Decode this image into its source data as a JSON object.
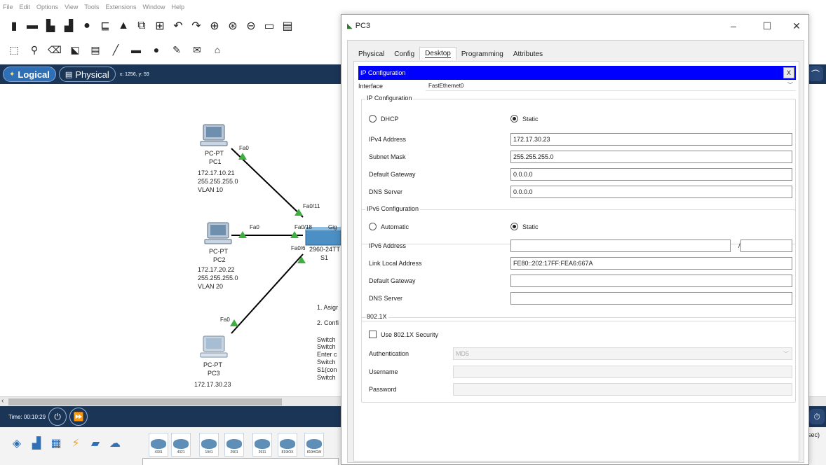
{
  "menu": [
    "File",
    "Edit",
    "Options",
    "View",
    "Tools",
    "Extensions",
    "Window",
    "Help"
  ],
  "toolbar1_icons": [
    "new-file-icon",
    "open-folder-icon",
    "save-icon",
    "print-icon",
    "activity-wizard-icon",
    "network-info-icon",
    "custom-device-icon",
    "copy-icon",
    "paste-icon",
    "undo-icon",
    "redo-icon",
    "zoom-in-icon",
    "zoom-reset-icon",
    "zoom-out-icon",
    "drawing-palette-icon",
    "custom-device-dialog-icon"
  ],
  "toolbar2_icons": [
    "select-icon",
    "inspect-icon",
    "delete-icon",
    "resize-icon",
    "place-note-icon",
    "draw-line-icon",
    "draw-rectangle-icon",
    "draw-ellipse-icon",
    "freeform-icon",
    "add-simple-pdu-icon",
    "add-complex-pdu-icon"
  ],
  "modebar": {
    "logical_label": "Logical",
    "physical_label": "Physical",
    "coords": "x: 1256, y: 59"
  },
  "topology": {
    "pc1": {
      "type": "PC-PT",
      "name": "PC1",
      "ip": "172.17.10.21",
      "mask": "255.255.255.0",
      "vlan": "VLAN 10",
      "port": "Fa0"
    },
    "pc2": {
      "type": "PC-PT",
      "name": "PC2",
      "ip": "172.17.20.22",
      "mask": "255.255.255.0",
      "vlan": "VLAN 20",
      "port": "Fa0"
    },
    "pc3": {
      "type": "PC-PT",
      "name": "PC3",
      "ip": "172.17.30.23",
      "port": "Fa0"
    },
    "switch": {
      "model": "2960-24TT",
      "name": "S1",
      "port_pc1": "Fa0/11",
      "port_pc2": "Fa0/18",
      "port_pc3": "Fa0/6",
      "port_uplink": "Gig"
    },
    "notes": [
      "1. Asigr",
      "2. Confi",
      "Switch",
      "Switch",
      "Enter c",
      "Switch",
      "S1(con",
      "Switch"
    ]
  },
  "time": "Time: 00:10:29",
  "device_models": [
    "4331",
    "4321",
    "1941",
    "2901",
    "2911",
    "819IOX",
    "819HGW"
  ],
  "sec_label": "sec)",
  "dialog": {
    "title": "PC3",
    "tabs": [
      "Physical",
      "Config",
      "Desktop",
      "Programming",
      "Attributes"
    ],
    "active_tab": "Desktop",
    "ip_config": {
      "header": "IP Configuration",
      "close": "X",
      "interface_label": "Interface",
      "interface_value": "FastEthernet0",
      "ipv4": {
        "title": "IP Configuration",
        "dhcp_label": "DHCP",
        "static_label": "Static",
        "mode": "Static",
        "address_label": "IPv4 Address",
        "address": "172.17.30.23",
        "mask_label": "Subnet Mask",
        "mask": "255.255.255.0",
        "gateway_label": "Default Gateway",
        "gateway": "0.0.0.0",
        "dns_label": "DNS Server",
        "dns": "0.0.0.0"
      },
      "ipv6": {
        "title": "IPv6 Configuration",
        "auto_label": "Automatic",
        "static_label": "Static",
        "mode": "Static",
        "address_label": "IPv6 Address",
        "address": "",
        "prefix": "",
        "slash": "/",
        "link_local_label": "Link Local Address",
        "link_local": "FE80::202:17FF:FEA6:667A",
        "gateway_label": "Default Gateway",
        "gateway": "",
        "dns_label": "DNS Server",
        "dns": ""
      },
      "dot1x": {
        "title": "802.1X",
        "use_label": "Use 802.1X Security",
        "enabled": false,
        "auth_label": "Authentication",
        "auth_value": "MD5",
        "user_label": "Username",
        "username": "",
        "pass_label": "Password",
        "password": ""
      }
    }
  },
  "colors": {
    "modebar_bg": "#1b3557",
    "ipconf_header_bg": "#0000ff",
    "link": "#000000",
    "link_endpoint": "#3fb03f"
  }
}
